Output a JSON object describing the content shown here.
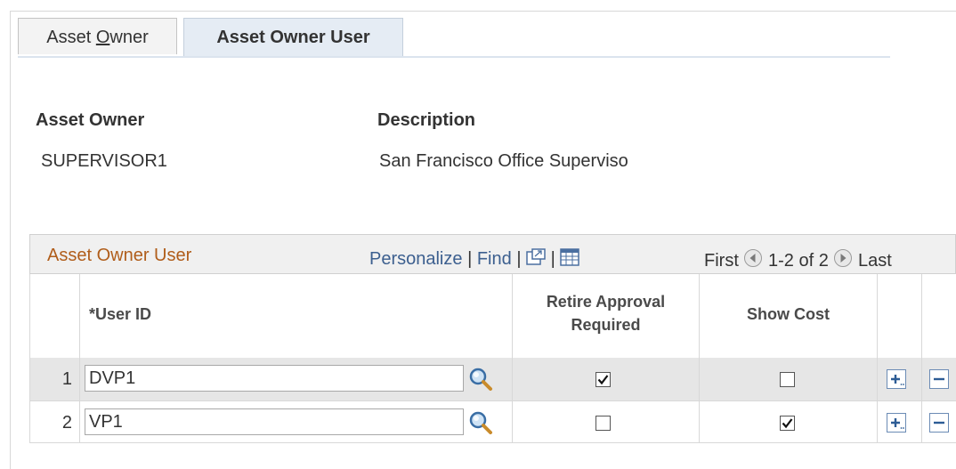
{
  "tabs": [
    {
      "label_pre": "Asset ",
      "label_u": "O",
      "label_post": "wner"
    },
    {
      "label": "Asset Owner User"
    }
  ],
  "header": {
    "owner_label": "Asset Owner",
    "owner_value": "SUPERVISOR1",
    "desc_label": "Description",
    "desc_value": "San Francisco Office Superviso"
  },
  "grid": {
    "title": "Asset Owner User",
    "personalize": "Personalize",
    "find": "Find",
    "sep": "|",
    "first": "First",
    "range": "1-2 of 2",
    "last": "Last",
    "columns": {
      "user_id": "*User ID",
      "retire_line1": "Retire Approval",
      "retire_line2": "Required",
      "show_cost": "Show Cost"
    },
    "rows": [
      {
        "num": "1",
        "user_id": "DVP1",
        "retire": true,
        "show_cost": false
      },
      {
        "num": "2",
        "user_id": "VP1",
        "retire": false,
        "show_cost": true
      }
    ]
  },
  "icons": {
    "lookup": "magnifier-icon",
    "add": "plus-icon",
    "delete": "minus-icon",
    "zoom": "new-window-icon",
    "download": "spreadsheet-icon"
  },
  "colors": {
    "link": "#3c5f8f",
    "grid_title": "#b05d1a",
    "active_tab": "#e5ecf4"
  }
}
